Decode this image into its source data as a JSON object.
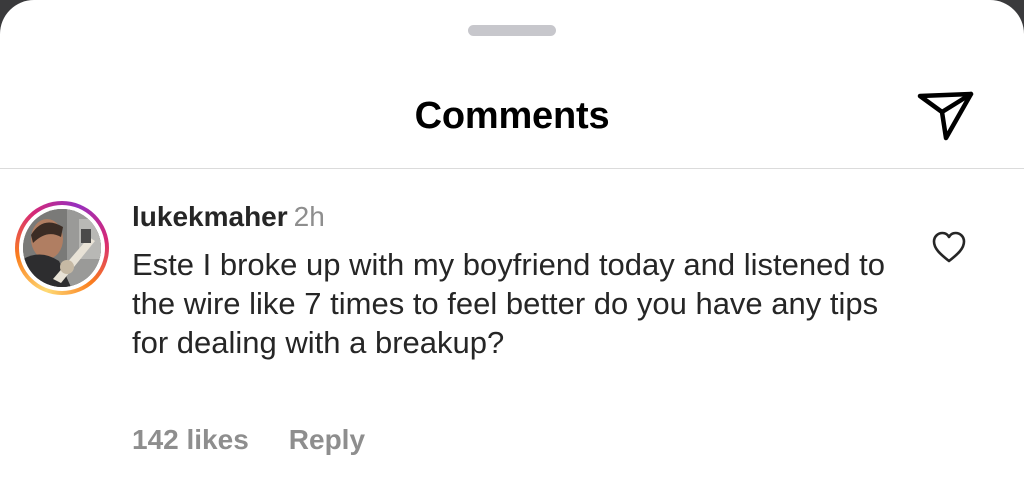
{
  "header": {
    "title": "Comments",
    "share_icon": "paper-plane-icon"
  },
  "comment": {
    "username": "lukekmaher",
    "time": "2h",
    "text": "Este I broke up with my boyfriend today and listened to the wire like 7 times to feel better do you have any tips for dealing with a breakup?",
    "likes": "142 likes",
    "reply_label": "Reply",
    "like_icon": "heart-outline-icon"
  },
  "colors": {
    "text_primary": "#262626",
    "text_secondary": "#8e8e8e",
    "divider": "#dbdbdb",
    "story_ring": [
      "#feda75",
      "#fa7e1e",
      "#d62976",
      "#962fbf"
    ]
  }
}
